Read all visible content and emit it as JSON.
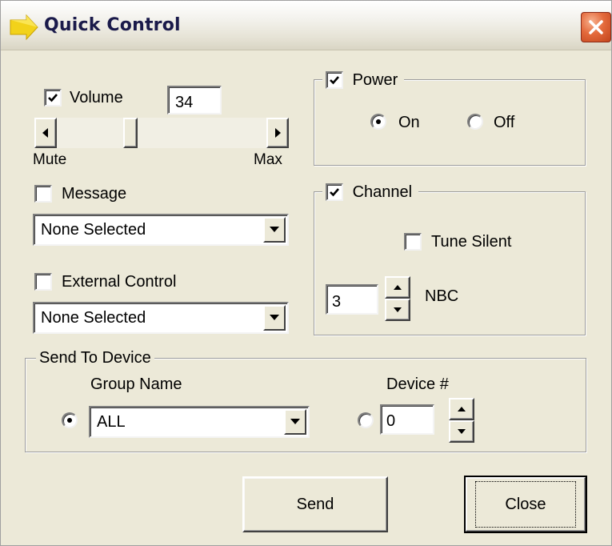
{
  "window": {
    "title": "Quick Control"
  },
  "volume": {
    "label": "Volume",
    "checked": true,
    "value": "34",
    "level": 0.34,
    "min_label": "Mute",
    "max_label": "Max"
  },
  "message": {
    "label": "Message",
    "checked": false,
    "selected": "None Selected"
  },
  "external_control": {
    "label": "External Control",
    "checked": false,
    "selected": "None Selected"
  },
  "power": {
    "label": "Power",
    "checked": true,
    "on_label": "On",
    "off_label": "Off",
    "selected": "On"
  },
  "channel": {
    "label": "Channel",
    "checked": true,
    "tune_silent_label": "Tune Silent",
    "tune_silent_checked": false,
    "number": "3",
    "name": "NBC"
  },
  "send_to_device": {
    "label": "Send To Device",
    "group_name_label": "Group Name",
    "group_selected": "ALL",
    "device_label": "Device #",
    "device_value": "0",
    "selected": "Group Name"
  },
  "buttons": {
    "send": "Send",
    "close": "Close"
  },
  "icons": {
    "title": "app-arrow-icon",
    "close": "close-icon",
    "check": "check-icon",
    "dropdown": "chevron-down-icon",
    "spin_up": "spin-up-icon",
    "spin_down": "spin-down-icon",
    "scroll_left": "scroll-left-icon",
    "scroll_right": "scroll-right-icon"
  },
  "colors": {
    "dialog_bg": "#ece9d8",
    "close_button": "#e46a3c",
    "title_text": "#1a1a4a"
  }
}
